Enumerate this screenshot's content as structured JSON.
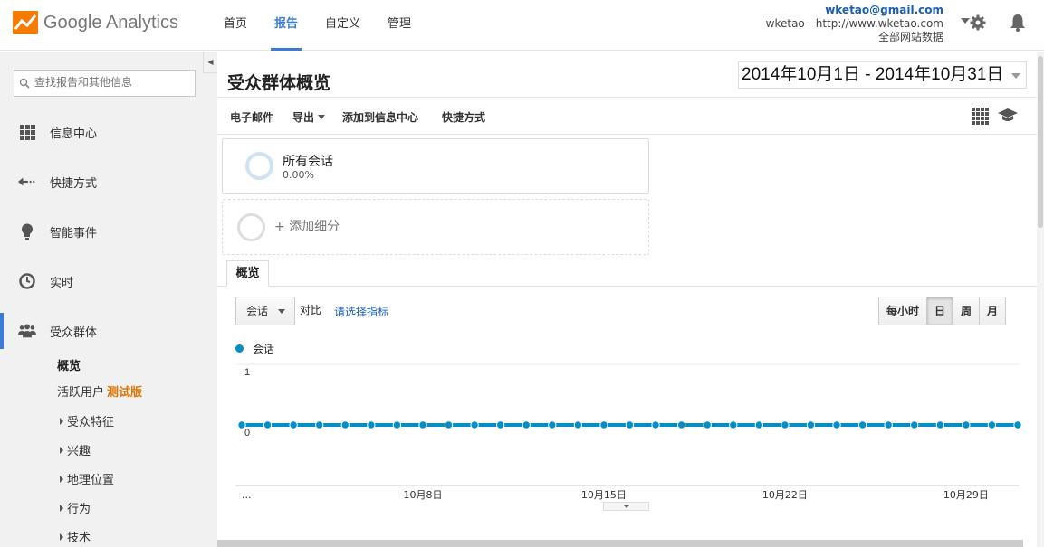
{
  "app": {
    "name": "Google Analytics"
  },
  "nav": {
    "tabs": [
      {
        "label": "首页"
      },
      {
        "label": "报告"
      },
      {
        "label": "自定义"
      },
      {
        "label": "管理"
      }
    ],
    "active": "报告"
  },
  "account": {
    "email": "wketao@gmail.com",
    "property": "wketao - http://www.wketao.com",
    "view": "全部网站数据"
  },
  "sidebar": {
    "search_placeholder": "查找报告和其他信息",
    "items": [
      {
        "label": "信息中心",
        "icon": "grid-icon"
      },
      {
        "label": "快捷方式",
        "icon": "shortcut-arrow-icon"
      },
      {
        "label": "智能事件",
        "icon": "lightbulb-icon"
      },
      {
        "label": "实时",
        "icon": "clock-icon"
      },
      {
        "label": "受众群体",
        "icon": "people-icon"
      }
    ],
    "sub": {
      "overview": "概览",
      "active_users": "活跃用户",
      "beta": "测试版",
      "groups": [
        "受众特征",
        "兴趣",
        "地理位置",
        "行为",
        "技术"
      ]
    }
  },
  "page": {
    "title": "受众群体概览",
    "date_range": "2014年10月1日 - 2014年10月31日"
  },
  "toolbar": {
    "email": "电子邮件",
    "export": "导出",
    "add_dashboard": "添加到信息中心",
    "shortcut": "快捷方式"
  },
  "segments": {
    "all_sessions": "所有会话",
    "all_sessions_pct": "0.00%",
    "add_segment": "+ 添加细分"
  },
  "tabs": {
    "overview": "概览"
  },
  "controls": {
    "metric": "会话",
    "vs": "对比",
    "pick_metric": "请选择指标",
    "periods": [
      "每小时",
      "日",
      "周",
      "月"
    ],
    "active_period": "日"
  },
  "chart_data": {
    "type": "line",
    "series": [
      {
        "name": "会话",
        "color": "#058dc7",
        "values": [
          0,
          0,
          0,
          0,
          0,
          0,
          0,
          0,
          0,
          0,
          0,
          0,
          0,
          0,
          0,
          0,
          0,
          0,
          0,
          0,
          0,
          0,
          0,
          0,
          0,
          0,
          0,
          0,
          0,
          0,
          0
        ]
      }
    ],
    "x_tick_labels": [
      "...",
      "10月8日",
      "10月15日",
      "10月22日",
      "10月29日"
    ],
    "x_tick_index": [
      0,
      7,
      14,
      21,
      28
    ],
    "y_tick_labels": [
      "1",
      "0"
    ],
    "ylim": [
      0,
      1
    ]
  }
}
